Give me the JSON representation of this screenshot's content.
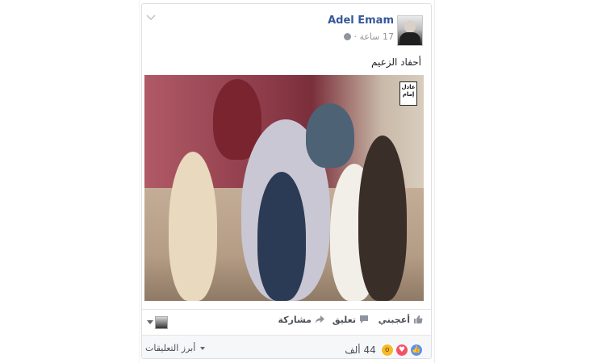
{
  "post": {
    "author": "Adel Emam",
    "meta_time": "17 ساعة ·",
    "caption": "أحفاد الزعيم",
    "photo_logo": "عادل إمام"
  },
  "actions": {
    "like": "أعجبني",
    "comment": "تعليق",
    "share": "مشاركة"
  },
  "footer": {
    "reaction_count": "44 ألف",
    "reactions": [
      "like-icon",
      "love-icon",
      "wow-icon"
    ],
    "top_comments": "أبرز التعليقات"
  },
  "colors": {
    "link": "#365899",
    "muted": "#90949c",
    "like_blue": "#5890ff",
    "love_red": "#f25268",
    "wow_yellow": "#f7b928"
  }
}
